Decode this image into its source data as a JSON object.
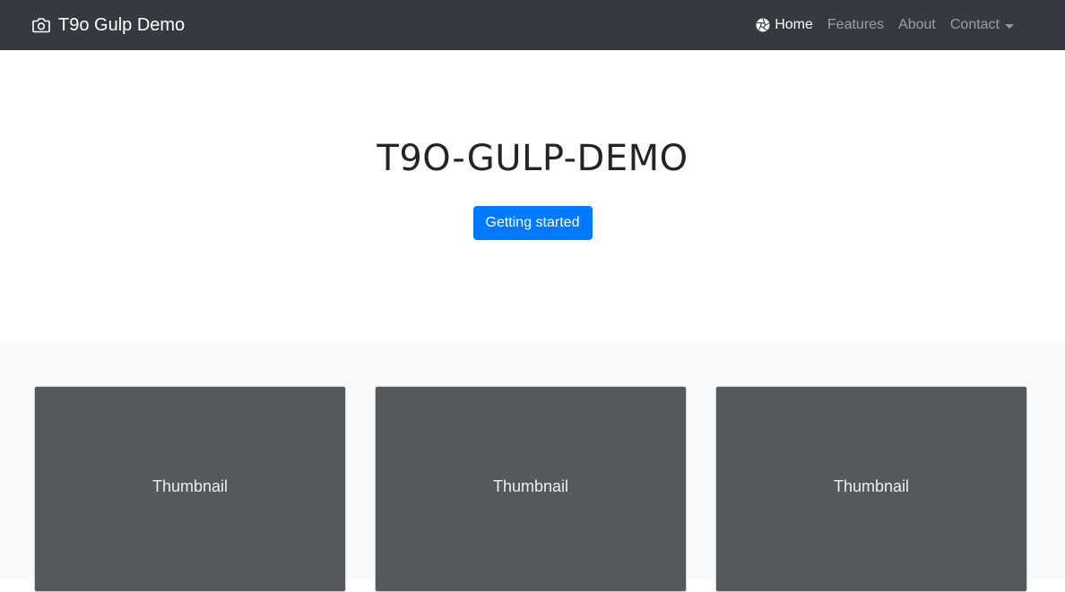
{
  "navbar": {
    "brand": "T9o Gulp Demo",
    "brand_icon": "camera-icon",
    "items": [
      {
        "label": "Home",
        "icon": "aperture-icon",
        "active": true
      },
      {
        "label": "Features"
      },
      {
        "label": "About"
      },
      {
        "label": "Contact",
        "dropdown": true
      }
    ],
    "background": "#343a40"
  },
  "hero": {
    "title": "T9O-GULP-DEMO",
    "button_label": "Getting started",
    "button_color": "#007bff"
  },
  "album": {
    "background": "#f8f9fa",
    "cards": [
      {
        "label": "Thumbnail"
      },
      {
        "label": "Thumbnail"
      },
      {
        "label": "Thumbnail"
      }
    ],
    "card_color": "#55595c"
  }
}
